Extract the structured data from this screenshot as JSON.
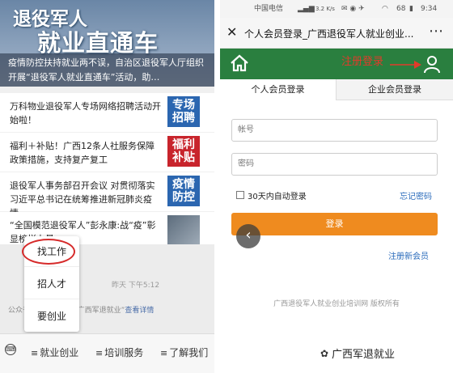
{
  "left": {
    "banner": {
      "title1": "退役军人",
      "title2": "就业直通车",
      "subtitle": "疫情防控扶持就业两不误，自治区退役军人厅组织开展“退役军人就业直通车”活动，助…"
    },
    "news": [
      {
        "text": "万科物业退役军人专场网络招聘活动开始啦！",
        "tag": "专场招聘",
        "tag_color": "#2b66b0"
      },
      {
        "text": "福利＋补贴！广西12条人社服务保障政策措施，支持复产复工",
        "tag": "福利补贴",
        "tag_color": "#c8242c"
      },
      {
        "text": "退役军人事务部召开会议 对贯彻落实习近平总书记在统筹推进新冠肺炎疫情…",
        "tag": "疫情防控",
        "tag_color": "#2b66b0"
      },
      {
        "text": "“全国模范退役军人”彭永康:战“疫”彰显榜样力量",
        "tag": "",
        "tag_color": "#7a8a9a"
      }
    ],
    "time_label": "昨天 下午5:12",
    "notice": {
      "prefix": "公众号已更改名称为“广西军退就业”",
      "link": "查看详情"
    },
    "popup": [
      "找工作",
      "招人才",
      "要创业"
    ],
    "bottom_menu": [
      "就业创业",
      "培训服务",
      "了解我们"
    ]
  },
  "right": {
    "status": {
      "carrier": "中国电信",
      "speed": "3.2 K/s",
      "battery": "68",
      "time": "9:34"
    },
    "title": "个人会员登录_广西退役军人就业创业...",
    "annotation": "注册登录",
    "tabs": [
      "个人会员登录",
      "企业会员登录"
    ],
    "account_placeholder": "帐号",
    "password_placeholder": "密码",
    "remember": "30天内自动登录",
    "forgot": "忘记密码",
    "login_button": "登录",
    "register": "注册新会员",
    "footer": "广西退役军人就业创业培训网 版权所有"
  },
  "watermark": "广西军退就业"
}
